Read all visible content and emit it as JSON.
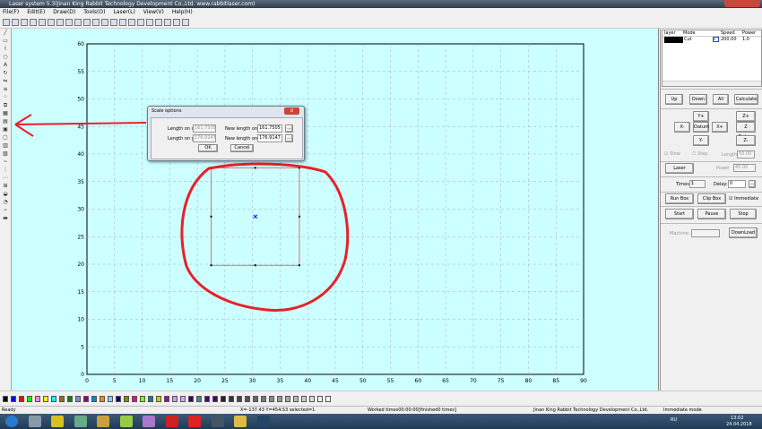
{
  "window": {
    "title": "Laser system 5.3(Jinan King Rabbit Technology Development Co.,Ltd. www.rabbitlaser.com)"
  },
  "menu": [
    "File(F)",
    "Edit(E)",
    "Draw(D)",
    "Tools(O)",
    "Laser(L)",
    "View(V)",
    "Help(H)"
  ],
  "toolbar_icons": [
    "new-icon",
    "open-icon",
    "save-icon",
    "print-icon",
    "select-icon",
    "node-icon",
    "zoom-in-icon",
    "zoom-out-icon",
    "pan-icon",
    "zoom-fit-icon",
    "zoom-page-icon",
    "undo-icon",
    "redo-icon",
    "group-icon",
    "ungroup-icon",
    "laser-cut-icon",
    "laser-path-icon",
    "array-icon",
    "preview-icon",
    "measure-icon",
    "settings-icon"
  ],
  "left_tools": [
    "line-icon",
    "rect-icon",
    "polyline-icon",
    "ellipse-icon",
    "text-icon",
    "rotate-icon",
    "mirror-icon",
    "align-icon",
    "points-icon",
    "scale-icon",
    "array-icon",
    "fill-icon",
    "group-icon",
    "ungroup-icon",
    "weld-icon",
    "offset-icon",
    "curve-icon",
    "grid-icon",
    "order-icon",
    "distribute-icon",
    "camera-icon",
    "layer-icon",
    "path-icon",
    "laser-icon"
  ],
  "canvas": {
    "x_ticks": [
      "0",
      "5",
      "10",
      "15",
      "20",
      "25",
      "30",
      "35",
      "40",
      "45",
      "50",
      "55",
      "60",
      "65",
      "70",
      "75",
      "80",
      "85",
      "90"
    ],
    "y_ticks": [
      "0",
      "5",
      "10",
      "15",
      "20",
      "25",
      "30",
      "35",
      "40",
      "45",
      "50",
      "55",
      "60"
    ],
    "selection": {
      "x0": 22.5,
      "x1": 38.5,
      "y0": 19.8,
      "y1": 37.5
    },
    "annotation_color": "#e8202a",
    "shape_color": "#e05050",
    "background": "#ccffff"
  },
  "dialog": {
    "title": "Scale options",
    "close": "x",
    "length_x_label": "Length on x:",
    "length_x": "161.7505",
    "length_y_label": "Length on y:",
    "length_y": "176.9147",
    "new_x_label": "New length on x:",
    "new_x": "161.7505",
    "new_y_label": "New length on y:",
    "new_y": "176.9147",
    "more": "...",
    "ok": "OK",
    "cancel": "Cancel"
  },
  "layers": {
    "headers": [
      "layer",
      "Mode",
      "Speed",
      "Power"
    ],
    "rows": [
      {
        "color": "#000000",
        "mode": "Cut",
        "speed": "200.00",
        "power": "1.0"
      }
    ]
  },
  "panel": {
    "up": "Up",
    "down": "Down",
    "all": "All",
    "calculate": "Calculate",
    "yplus": "Y+",
    "yminus": "Y-",
    "xminus": "X-",
    "xplus": "X+",
    "datum": "Datum",
    "zplus": "Z+",
    "zdatum": "Z Datum",
    "zminus": "Z-",
    "slow": "Slow",
    "step": "Step",
    "length_label": "Length",
    "length": "50.00",
    "laser": "Laser",
    "power_label": "Power",
    "power": "45.00",
    "times_label": "Times:",
    "times": "1",
    "delay_label": "Delay:",
    "delay": "0",
    "more": "...",
    "run_box": "Run Box",
    "clip_box": "Clip Box",
    "immediate": "Immediate",
    "start": "Start",
    "pause": "Pause",
    "stop": "Stop",
    "machine_label": "Machine:",
    "download": "DownLoad"
  },
  "palette": [
    "#000000",
    "#0000ff",
    "#ff0000",
    "#00ff00",
    "#ff88cc",
    "#ffff00",
    "#00ffff",
    "#996633",
    "#008800",
    "#8888cc",
    "#880088",
    "#0088cc",
    "#ff8800",
    "#88ccff",
    "#000088",
    "#888800",
    "#ff0088",
    "#88ff00",
    "#008888",
    "#cccc00",
    "#aa00aa",
    "#cc99ff",
    "#ccaaff",
    "#440044",
    "#448888",
    "#440088",
    "#440066",
    "#222222",
    "#333333",
    "#444444",
    "#555555",
    "#666666",
    "#777777",
    "#888888",
    "#999999",
    "#aaaaaa",
    "#bbbbbb",
    "#cccccc",
    "#dddddd",
    "#eeeeee",
    "#ffffff"
  ],
  "status": {
    "ready": "Ready",
    "coords": "X=-137.43 Y=454.53 selected=1",
    "worked": "Worked times00:00:00[finished0 times]",
    "company": "Jinan King Rabbit Technology Development Co.,Ltd.",
    "mode": "Immediate mode"
  },
  "taskbar": {
    "items": [
      "start-icon",
      "calculator-icon",
      "radiation-icon",
      "paint-icon",
      "explorer-icon",
      "notepad-icon",
      "pen-icon",
      "acrobat-icon",
      "yandex-icon",
      "app-icon",
      "paint-app-icon",
      "laser-app-icon"
    ],
    "lang": "RU",
    "time": "13:02",
    "date": "24.04.2018"
  }
}
